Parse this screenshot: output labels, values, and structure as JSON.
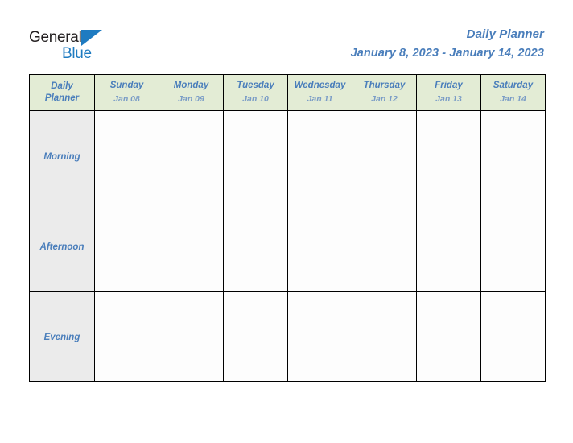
{
  "brand": {
    "word_one": "General",
    "word_two": "Blue",
    "triangle_icon": "triangle-icon"
  },
  "header": {
    "title": "Daily Planner",
    "date_range": "January 8, 2023 - January 14, 2023"
  },
  "planner": {
    "corner": {
      "line1": "Daily",
      "line2": "Planner"
    },
    "days": [
      {
        "name": "Sunday",
        "date": "Jan 08"
      },
      {
        "name": "Monday",
        "date": "Jan 09"
      },
      {
        "name": "Tuesday",
        "date": "Jan 10"
      },
      {
        "name": "Wednesday",
        "date": "Jan 11"
      },
      {
        "name": "Thursday",
        "date": "Jan 12"
      },
      {
        "name": "Friday",
        "date": "Jan 13"
      },
      {
        "name": "Saturday",
        "date": "Jan 14"
      }
    ],
    "rows": [
      {
        "label": "Morning",
        "cells": [
          "",
          "",
          "",
          "",
          "",
          "",
          ""
        ]
      },
      {
        "label": "Afternoon",
        "cells": [
          "",
          "",
          "",
          "",
          "",
          "",
          ""
        ]
      },
      {
        "label": "Evening",
        "cells": [
          "",
          "",
          "",
          "",
          "",
          "",
          ""
        ]
      }
    ]
  },
  "colors": {
    "accent_blue": "#4a7ebb",
    "logo_blue": "#1e7bc1",
    "header_green": "#e3ecd5",
    "row_label_gray": "#ebebeb",
    "grid_line": "#000000",
    "page_background": "#ffffff"
  }
}
